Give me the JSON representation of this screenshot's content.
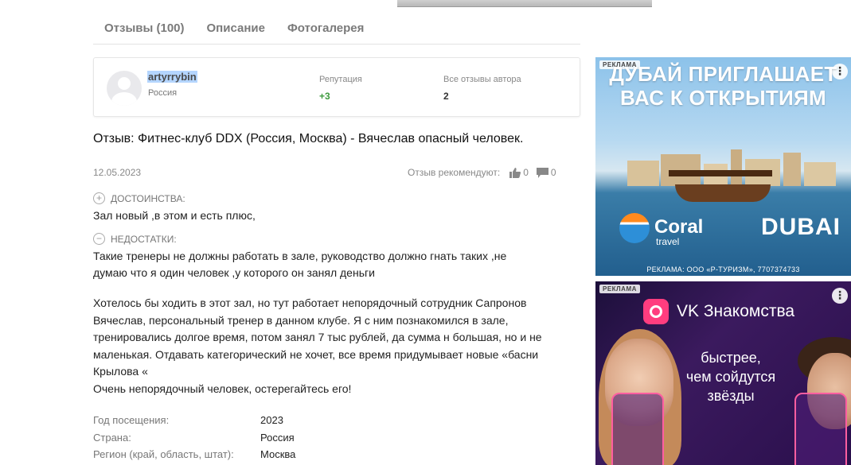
{
  "tabs": [
    {
      "label": "Отзывы (100)"
    },
    {
      "label": "Описание"
    },
    {
      "label": "Фотогалерея"
    }
  ],
  "author": {
    "name": "artyrrybin",
    "country": "Россия",
    "reputation_label": "Репутация",
    "reputation_value": "+3",
    "all_reviews_label": "Все отзывы автора",
    "all_reviews_value": "2"
  },
  "review": {
    "title": "Отзыв: Фитнес-клуб DDX (Россия, Москва) - Вячеслав опасный человек.",
    "date": "12.05.2023",
    "recommend_label": "Отзыв рекомендуют:",
    "likes": "0",
    "comments": "0",
    "pros_label": "ДОСТОИНСТВА:",
    "pros_text": "Зал новый ,в этом и есть плюс,",
    "cons_label": "НЕДОСТАТКИ:",
    "cons_lines": [
      "Такие тренеры не должны работать в зале, руководство должно гнать таких ,не",
      "думаю что я один человек ,у которого он занял деньги"
    ],
    "body_lines": [
      "Хотелось бы ходить в этот зал, но тут работает непорядочный сотрудник Сапронов",
      "Вячеслав, персональный тренер в данном клубе. Я с ним познакомился в зале,",
      "тренировались долгое время, потом занял 7 тыс рублей, да сумма н большая, но и не",
      "маленькая. Отдавать категорический не хочет, все время придумывает новые «басни",
      "Крылова «",
      "Очень непорядочный человек, остерегайтесь его!"
    ]
  },
  "meta": [
    {
      "label": "Год посещения:",
      "value": "2023"
    },
    {
      "label": "Страна:",
      "value": "Россия"
    },
    {
      "label": "Регион (край, область, штат):",
      "value": "Москва"
    }
  ],
  "ads": {
    "tag": "РЕКЛАМА",
    "ad1": {
      "headline_lines": [
        "ДУБАЙ ПРИГЛАШАЕТ",
        "ВАС К ОТКРЫТИЯМ"
      ],
      "brand": "Coral",
      "brand_sub": "travel",
      "dubai": "DUBAI",
      "footer": "РЕКЛАМА: ООО «Р-ТУРИЗМ», 7707374733"
    },
    "ad2": {
      "title": "VK Знакомства",
      "sub_lines": [
        "быстрее,",
        "чем сойдутся",
        "звёзды"
      ]
    }
  },
  "colors": {
    "tab_text": "#7a7a7a",
    "reputation": "#3d9a3d",
    "name_highlight": "#b4d5fe",
    "vk_pink": "#ff3d7f"
  }
}
